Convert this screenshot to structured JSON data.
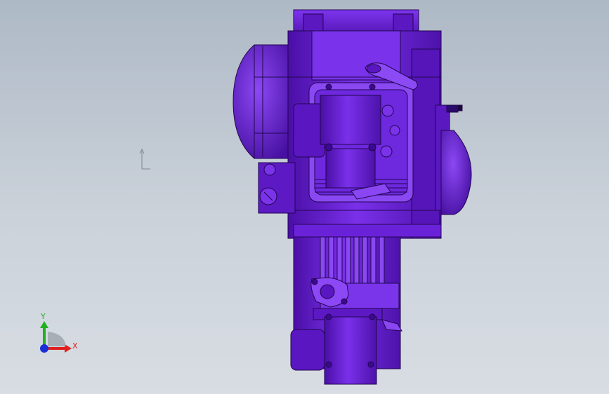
{
  "viewport": {
    "background_top": "#aeb9c6",
    "background_bottom": "#d8dde3"
  },
  "model": {
    "name": "engine-assembly",
    "base_color": "#6a1fd8",
    "shade_color": "#4a0fa6",
    "light_color": "#8a45f2",
    "edge_color": "#220650"
  },
  "triad": {
    "x_label": "X",
    "y_label": "Y",
    "x_color": "#e0201e",
    "y_color": "#20b020",
    "z_color": "#1a2ed8"
  }
}
